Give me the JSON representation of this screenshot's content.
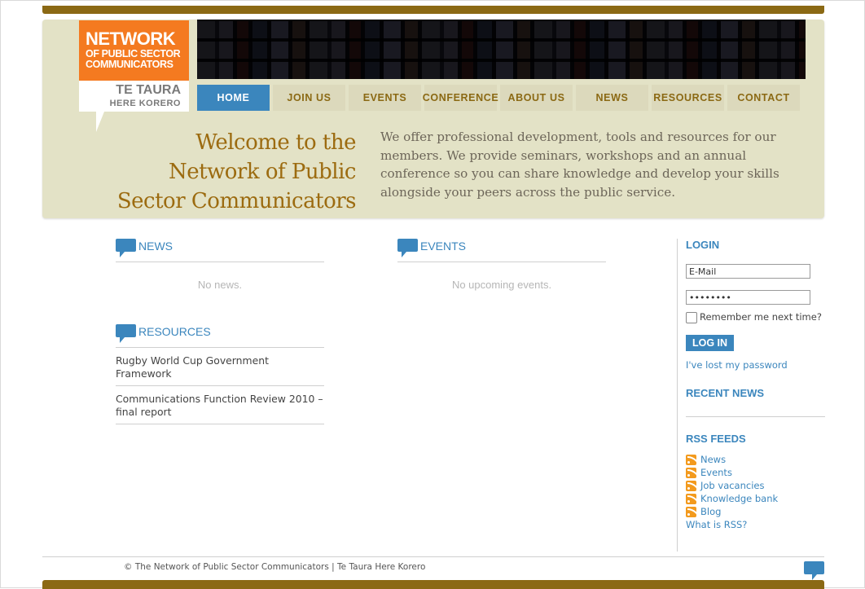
{
  "logo": {
    "line1": "NETWORK",
    "line2a": "OF PUBLIC SECTOR",
    "line2b": "COMMUNICATORS",
    "maori1": "TE TAURA",
    "maori2": "HERE KORERO"
  },
  "nav": {
    "tabs": [
      {
        "label": "HOME",
        "active": true
      },
      {
        "label": "JOIN US"
      },
      {
        "label": "EVENTS"
      },
      {
        "label": "CONFERENCE"
      },
      {
        "label": "ABOUT US"
      },
      {
        "label": "NEWS"
      },
      {
        "label": "RESOURCES"
      },
      {
        "label": "CONTACT"
      }
    ]
  },
  "hero": {
    "welcome_line1": "Welcome to the",
    "welcome_line2": "Network of Public",
    "welcome_line3": "Sector Communicators",
    "intro": "We offer professional development, tools and resources for our members. We provide seminars, workshops and an annual conference so you can share knowledge and develop your skills alongside your peers across the public service."
  },
  "news": {
    "title": "NEWS",
    "empty": "No news."
  },
  "events": {
    "title": "EVENTS",
    "empty": "No upcoming events."
  },
  "resources": {
    "title": "RESOURCES",
    "items": [
      "Rugby World Cup Government Framework",
      "Communications Function Review 2010 – final report"
    ]
  },
  "sidebar": {
    "login_title": "LOGIN",
    "email_placeholder": "E-Mail",
    "password_mask": "••••••••",
    "remember_label": "Remember me next time?",
    "login_button": "LOG IN",
    "lost_password": "I've lost my password",
    "recent_news_title": "RECENT NEWS",
    "rss_title": "RSS FEEDS",
    "rss_items": [
      "News",
      "Events",
      "Job vacancies",
      "Knowledge bank",
      "Blog"
    ],
    "what_is_rss": "What is RSS?"
  },
  "footer": {
    "copyright": "© The Network of Public Sector Communicators | Te Taura Here Korero"
  },
  "colors": {
    "brand_brown": "#8b6914",
    "brand_blue": "#3b86bd",
    "logo_orange": "#f47a20",
    "header_beige": "#e3e2c6"
  }
}
